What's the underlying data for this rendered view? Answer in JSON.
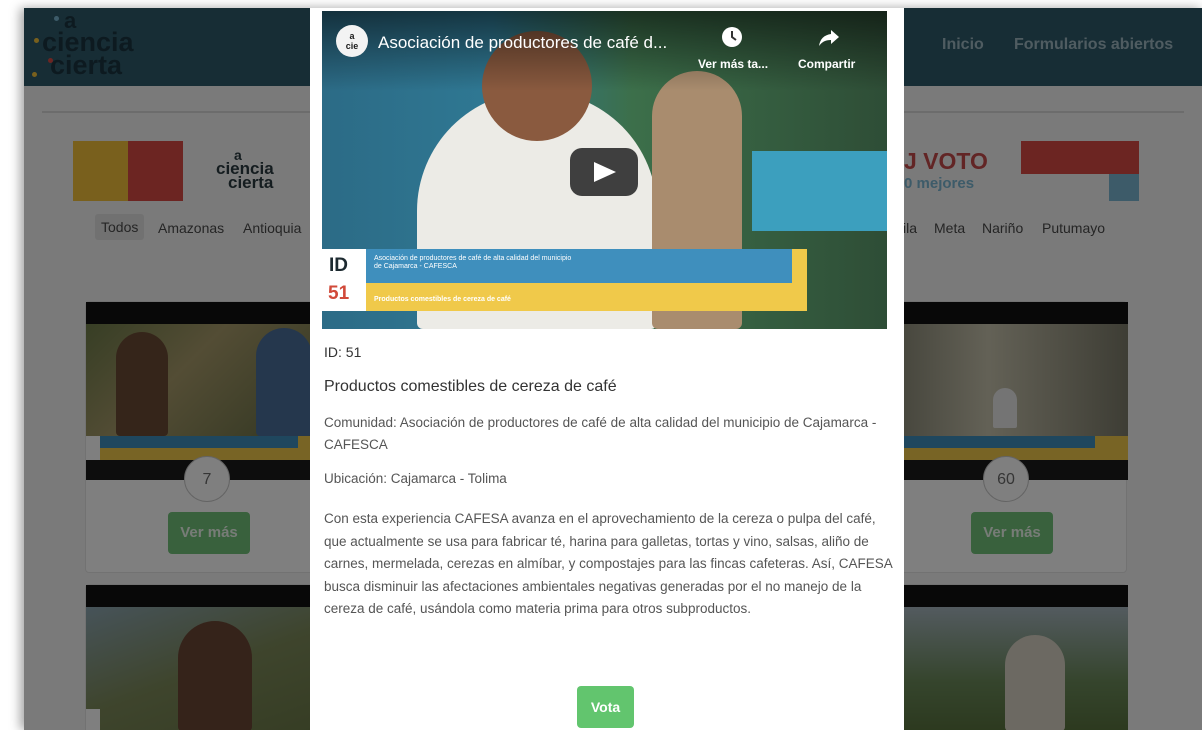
{
  "header": {
    "logo": {
      "line1": "a",
      "line2": "ciencia",
      "line3": "cierta"
    },
    "nav": {
      "home": "Inicio",
      "open_forms": "Formularios abiertos"
    }
  },
  "banner": {
    "logo": {
      "line1": "a",
      "line2": "ciencia",
      "line3": "cierta"
    },
    "vote_title": "J VOTO",
    "vote_subtitle": "0 mejores"
  },
  "filters": {
    "selected": "Todos",
    "left": [
      "Todos",
      "Amazonas",
      "Antioquia"
    ],
    "right": [
      "ila",
      "Meta",
      "Nariño",
      "Putumayo"
    ]
  },
  "cards": {
    "left": {
      "number": "7",
      "button": "Ver más"
    },
    "right": {
      "number": "60",
      "button": "Ver más"
    }
  },
  "modal": {
    "video": {
      "channel": "a ciencia cierta",
      "title": "Asociación de productores de café d...",
      "watch_later": "Ver más ta...",
      "share": "Compartir",
      "lower_third": {
        "id_label": "ID",
        "id_number": "51",
        "community": "Asociación de productores de café de alta calidad del municipio de Cajamarca - CAFESCA",
        "product": "Productos comestibles de cereza de café"
      }
    },
    "id": "ID: 51",
    "title": "Productos comestibles de cereza de café",
    "community": "Comunidad: Asociación de productores de café de alta calidad del municipio de Cajamarca - CAFESCA",
    "location": "Ubicación: Cajamarca - Tolima",
    "description": "Con esta experiencia CAFESA avanza en el aprovechamiento de la cereza o pulpa del café, que actualmente se usa para fabricar té, harina para galletas, tortas y vino, salsas, aliño de carnes, mermelada, cerezas en almíbar, y compostajes para las fincas cafeteras. Así, CAFESA busca disminuir las afectaciones ambientales negativas generadas por el no manejo de la cereza de café, usándola como materia prima para otros subproductos.",
    "vote_button": "Vota"
  },
  "colors": {
    "header": "#2f5b6b",
    "accent_green": "#62c56e",
    "brand_red": "#d94a45",
    "brand_yellow": "#f3c13a",
    "brand_blue": "#7bb7d3"
  }
}
